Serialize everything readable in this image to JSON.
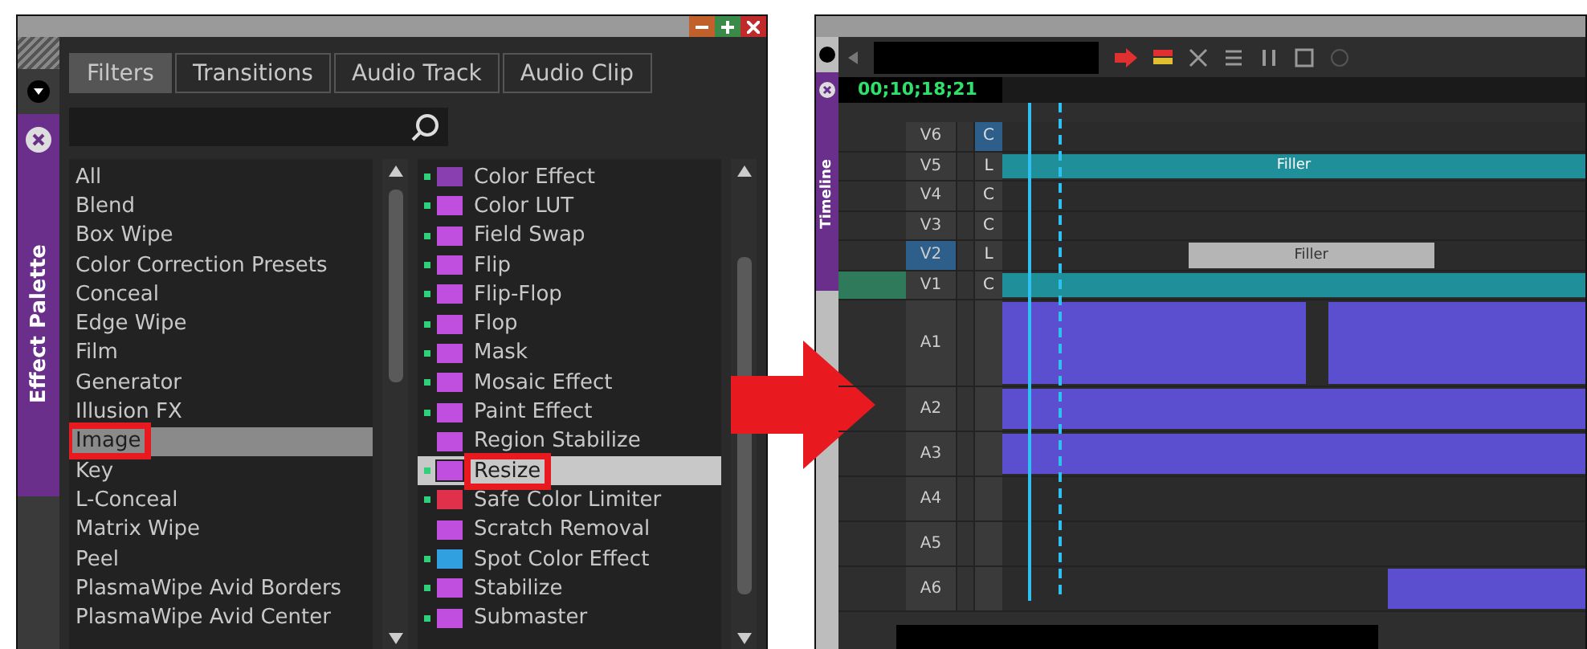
{
  "effect_palette": {
    "side_label": "Effect Palette",
    "tabs": [
      {
        "label": "Filters",
        "selected": true
      },
      {
        "label": "Transitions",
        "selected": false
      },
      {
        "label": "Audio Track",
        "selected": false
      },
      {
        "label": "Audio Clip",
        "selected": false
      }
    ],
    "categories": [
      {
        "label": "All",
        "selected": false,
        "annotated": false
      },
      {
        "label": "Blend",
        "selected": false,
        "annotated": false
      },
      {
        "label": "Box Wipe",
        "selected": false,
        "annotated": false
      },
      {
        "label": "Color Correction Presets",
        "selected": false,
        "annotated": false
      },
      {
        "label": "Conceal",
        "selected": false,
        "annotated": false
      },
      {
        "label": "Edge Wipe",
        "selected": false,
        "annotated": false
      },
      {
        "label": "Film",
        "selected": false,
        "annotated": false
      },
      {
        "label": "Generator",
        "selected": false,
        "annotated": false
      },
      {
        "label": "Illusion FX",
        "selected": false,
        "annotated": false
      },
      {
        "label": "Image",
        "selected": true,
        "annotated": true
      },
      {
        "label": "Key",
        "selected": false,
        "annotated": false
      },
      {
        "label": "L-Conceal",
        "selected": false,
        "annotated": false
      },
      {
        "label": "Matrix Wipe",
        "selected": false,
        "annotated": false
      },
      {
        "label": "Peel",
        "selected": false,
        "annotated": false
      },
      {
        "label": "PlasmaWipe Avid Borders",
        "selected": false,
        "annotated": false
      },
      {
        "label": "PlasmaWipe Avid Center",
        "selected": false,
        "annotated": false
      }
    ],
    "effects": [
      {
        "label": "Color Effect",
        "selected": false,
        "annotated": false,
        "enabled": true,
        "color": "#8a3fb0"
      },
      {
        "label": "Color LUT",
        "selected": false,
        "annotated": false,
        "enabled": true,
        "color": "#c04fe0"
      },
      {
        "label": "Field Swap",
        "selected": false,
        "annotated": false,
        "enabled": true,
        "color": "#c04fe0"
      },
      {
        "label": "Flip",
        "selected": false,
        "annotated": false,
        "enabled": true,
        "color": "#c04fe0"
      },
      {
        "label": "Flip-Flop",
        "selected": false,
        "annotated": false,
        "enabled": true,
        "color": "#c04fe0"
      },
      {
        "label": "Flop",
        "selected": false,
        "annotated": false,
        "enabled": true,
        "color": "#c04fe0"
      },
      {
        "label": "Mask",
        "selected": false,
        "annotated": false,
        "enabled": true,
        "color": "#c04fe0"
      },
      {
        "label": "Mosaic Effect",
        "selected": false,
        "annotated": false,
        "enabled": true,
        "color": "#c04fe0"
      },
      {
        "label": "Paint Effect",
        "selected": false,
        "annotated": false,
        "enabled": true,
        "color": "#c04fe0"
      },
      {
        "label": "Region Stabilize",
        "selected": false,
        "annotated": false,
        "enabled": false,
        "color": "#c04fe0"
      },
      {
        "label": "Resize",
        "selected": true,
        "annotated": true,
        "enabled": true,
        "color": "#c04fe0"
      },
      {
        "label": "Safe Color Limiter",
        "selected": false,
        "annotated": false,
        "enabled": true,
        "color": "#e0304a"
      },
      {
        "label": "Scratch Removal",
        "selected": false,
        "annotated": false,
        "enabled": false,
        "color": "#c04fe0"
      },
      {
        "label": "Spot Color Effect",
        "selected": false,
        "annotated": false,
        "enabled": true,
        "color": "#30a0e0"
      },
      {
        "label": "Stabilize",
        "selected": false,
        "annotated": false,
        "enabled": true,
        "color": "#c04fe0"
      },
      {
        "label": "Submaster",
        "selected": false,
        "annotated": false,
        "enabled": true,
        "color": "#c04fe0"
      }
    ]
  },
  "timeline": {
    "side_label": "Timeline",
    "timecode": "00;10;18;21",
    "tracks": [
      {
        "label": "V6",
        "kind": "video",
        "selected": false,
        "sync": "C",
        "sync_selected": true
      },
      {
        "label": "V5",
        "kind": "video",
        "selected": false,
        "sync": "L",
        "sync_selected": false,
        "clips": [
          {
            "kind": "filler",
            "label": "Filler"
          }
        ]
      },
      {
        "label": "V4",
        "kind": "video",
        "selected": false,
        "sync": "C",
        "sync_selected": false
      },
      {
        "label": "V3",
        "kind": "video",
        "selected": false,
        "sync": "C",
        "sync_selected": false
      },
      {
        "label": "V2",
        "kind": "video",
        "selected": true,
        "sync": "L",
        "sync_selected": false,
        "clips": [
          {
            "kind": "gray",
            "label": "Filler"
          }
        ]
      },
      {
        "label": "V1",
        "kind": "video",
        "selected": false,
        "sync": "C",
        "sync_selected": false,
        "clips": [
          {
            "kind": "filler"
          }
        ]
      },
      {
        "label": "A1",
        "kind": "audio",
        "selected": false,
        "clips": [
          {
            "kind": "audio"
          },
          {
            "kind": "audio"
          }
        ]
      },
      {
        "label": "A2",
        "kind": "audio",
        "selected": false,
        "clips": [
          {
            "kind": "audio"
          }
        ]
      },
      {
        "label": "A3",
        "kind": "audio",
        "selected": false,
        "clips": [
          {
            "kind": "audio"
          }
        ]
      },
      {
        "label": "A4",
        "kind": "audio",
        "selected": false
      },
      {
        "label": "A5",
        "kind": "audio",
        "selected": false
      },
      {
        "label": "A6",
        "kind": "audio",
        "selected": false,
        "clips": [
          {
            "kind": "audio"
          }
        ]
      }
    ]
  }
}
